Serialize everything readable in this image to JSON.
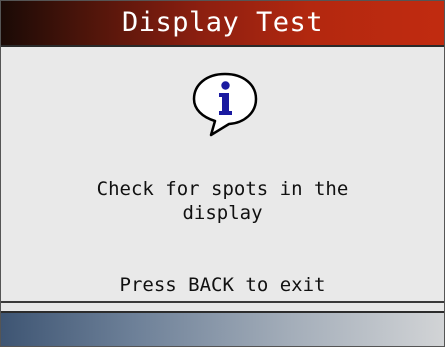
{
  "header": {
    "title": "Display Test"
  },
  "main": {
    "icon": "info-speech-bubble-icon",
    "message": "Check for spots in the\ndisplay",
    "hint": "Press BACK to exit"
  },
  "colors": {
    "title_bar_dark": "#1a0a06",
    "title_bar_red": "#c12b10",
    "icon_blue": "#1a1aa0",
    "footer_blue": "#3e5573",
    "footer_light": "#d2d4d6",
    "background": "#e9e9e9"
  }
}
